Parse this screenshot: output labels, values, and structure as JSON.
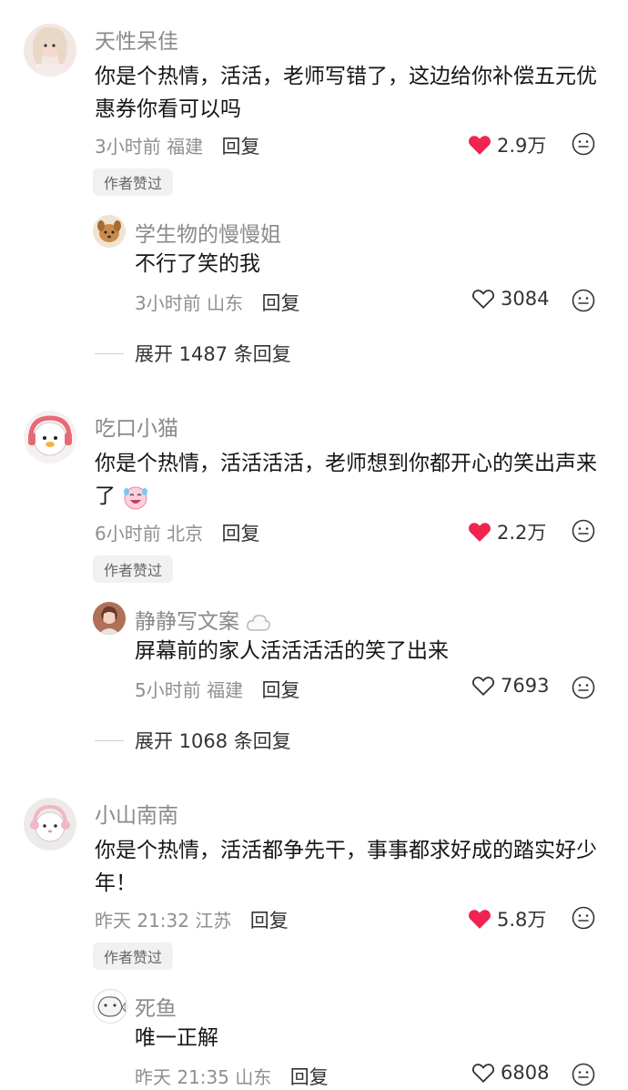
{
  "comments": [
    {
      "user": "天性呆佳",
      "text": "你是个热情，活活，老师写错了，这边给你补偿五元优惠券你看可以吗",
      "time": "3小时前",
      "location": "福建",
      "reply_label": "回复",
      "likes": "2.9万",
      "liked": true,
      "badge": "作者赞过",
      "reply": {
        "user": "学生物的慢慢姐",
        "text": "不行了笑的我",
        "time": "3小时前",
        "location": "山东",
        "reply_label": "回复",
        "likes": "3084"
      },
      "expand": "展开 1487 条回复"
    },
    {
      "user": "吃口小猫",
      "text": "你是个热情，活活活活，老师想到你都开心的笑出声来了",
      "time": "6小时前",
      "location": "北京",
      "reply_label": "回复",
      "likes": "2.2万",
      "liked": true,
      "badge": "作者赞过",
      "reply": {
        "user": "静静写文案",
        "text": "屏幕前的家人活活活活的笑了出来",
        "time": "5小时前",
        "location": "福建",
        "reply_label": "回复",
        "likes": "7693"
      },
      "expand": "展开 1068 条回复"
    },
    {
      "user": "小山南南",
      "text": "你是个热情，活活都争先干，事事都求好成的踏实好少年！",
      "time": "昨天 21:32",
      "location": "江苏",
      "reply_label": "回复",
      "likes": "5.8万",
      "liked": true,
      "badge": "作者赞过",
      "reply": {
        "user": "死鱼",
        "text": "唯一正解",
        "time": "昨天 21:35",
        "location": "山东",
        "reply_label": "回复",
        "likes": "6808"
      }
    }
  ],
  "colors": {
    "heart": "#f0244f",
    "meta": "#8f8f8f",
    "badge_bg": "#f1f1f1"
  }
}
